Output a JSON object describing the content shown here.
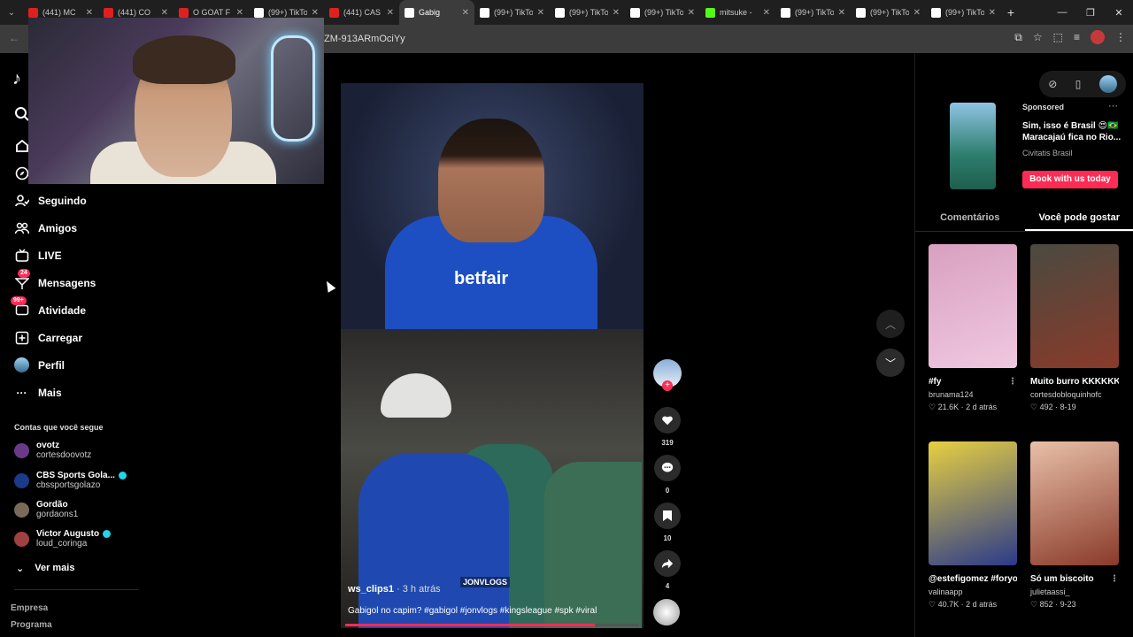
{
  "browser": {
    "tabs": [
      {
        "label": "(441) MC",
        "color": "#e02020"
      },
      {
        "label": "(441) CO",
        "color": "#e02020"
      },
      {
        "label": "O GOAT F",
        "color": "#e02020"
      },
      {
        "label": "(99+) TikTo",
        "color": "#ffffff"
      },
      {
        "label": "(441) CAS",
        "color": "#e02020"
      },
      {
        "label": "Gabig",
        "color": "#ffffff",
        "active": true
      },
      {
        "label": "(99+) TikTo",
        "color": "#ffffff"
      },
      {
        "label": "(99+) TikTo",
        "color": "#ffffff"
      },
      {
        "label": "(99+) TikTo",
        "color": "#ffffff"
      },
      {
        "label": "mitsuke -",
        "color": "#53fc18"
      },
      {
        "label": "(99+) TikTo",
        "color": "#ffffff"
      },
      {
        "label": "(99+) TikTo",
        "color": "#ffffff"
      },
      {
        "label": "(99+) TikTo",
        "color": "#ffffff"
      }
    ],
    "url": "ZM-913ARmOciYy"
  },
  "nav": {
    "seguindo": "Seguindo",
    "amigos": "Amigos",
    "live": "LIVE",
    "mensagens": "Mensagens",
    "mensagens_badge": "24",
    "atividade": "Atividade",
    "atividade_badge": "99+",
    "carregar": "Carregar",
    "perfil": "Perfil",
    "mais": "Mais"
  },
  "following": {
    "heading": "Contas que você segue",
    "accounts": [
      {
        "name": "ovotz",
        "username": "cortesdoovotz",
        "verified": false,
        "color": "#6a3a8a"
      },
      {
        "name": "CBS Sports Gola...",
        "username": "cbssportsgolazo",
        "verified": true,
        "color": "#1a3a8a"
      },
      {
        "name": "Gordão",
        "username": "gordaons1",
        "verified": false,
        "color": "#7a6a5a"
      },
      {
        "name": "Victor Augusto",
        "username": "loud_coringa",
        "verified": true,
        "color": "#a04040"
      }
    ],
    "ver_mais": "Ver mais"
  },
  "footer": {
    "empresa": "Empresa",
    "programa": "Programa"
  },
  "video": {
    "author": "ws_clips1",
    "time": " · 3 h atrás",
    "description": "Gabigol no capim? #gabigol #jonvlogs #kingsleague #spk #viral",
    "watermark": "JONVLOGS",
    "jersey_brand": "betfair",
    "progress": 0.85
  },
  "actions": {
    "likes": "319",
    "comments": "0",
    "saves": "10",
    "shares": "4"
  },
  "ad": {
    "sponsored": "Sponsored",
    "title": "Sim, isso é Brasil 😍🇧🇷 Maracajaú fica no Rio...",
    "brand": "Civitatis Brasil",
    "cta": "Book with us today"
  },
  "right_tabs": {
    "comments": "Comentários",
    "suggested": "Você pode gostar"
  },
  "recommendations": [
    {
      "title": "#fy",
      "user": "brunama124",
      "meta": "♡ 21.6K · 2 d atrás",
      "color1": "#d8a0c0",
      "color2": "#f0c8e0"
    },
    {
      "title": "Muito burro KKKKKK #fortnit...",
      "user": "cortesdobloquinhofc",
      "meta": "♡ 492 · 8-19",
      "color1": "#4a4a40",
      "color2": "#8a3a2a"
    },
    {
      "title": "@estefigomez #foryoupage",
      "user": "valinaapp",
      "meta": "♡ 40.7K · 2 d atrás",
      "color1": "#e8d040",
      "color2": "#2a3a8a"
    },
    {
      "title": "Só um biscoito",
      "user": "julietaassi_",
      "meta": "♡ 852 · 9-23",
      "color1": "#e8c0a8",
      "color2": "#8a3a2a"
    }
  ]
}
